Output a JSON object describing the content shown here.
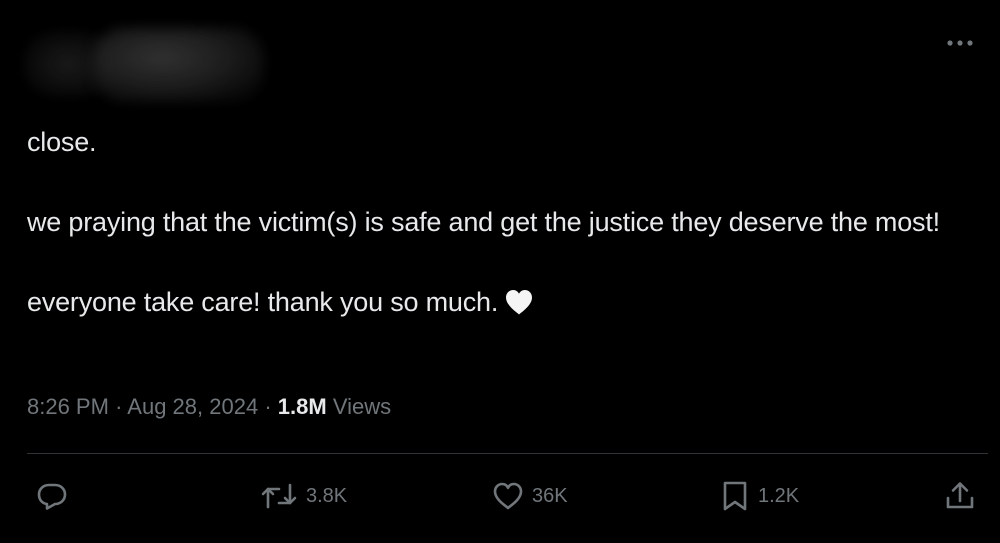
{
  "tweet": {
    "paragraphs": [
      "close.",
      "we praying that the victim(s) is safe and get the justice they deserve the most!",
      "everyone take care! thank you so much."
    ],
    "emoji": "white-heart"
  },
  "meta": {
    "time": "8:26 PM",
    "separator": "·",
    "date": "Aug 28, 2024",
    "views_count": "1.8M",
    "views_label": "Views"
  },
  "actions": {
    "reply": {
      "icon": "reply-icon",
      "count": ""
    },
    "retweet": {
      "icon": "retweet-icon",
      "count": "3.8K"
    },
    "like": {
      "icon": "heart-icon",
      "count": "36K"
    },
    "bookmark": {
      "icon": "bookmark-icon",
      "count": "1.2K"
    },
    "share": {
      "icon": "share-icon",
      "count": ""
    }
  },
  "colors": {
    "background": "#000000",
    "text": "#e7e9ea",
    "secondary": "#71767b",
    "divider": "#2f3336"
  }
}
